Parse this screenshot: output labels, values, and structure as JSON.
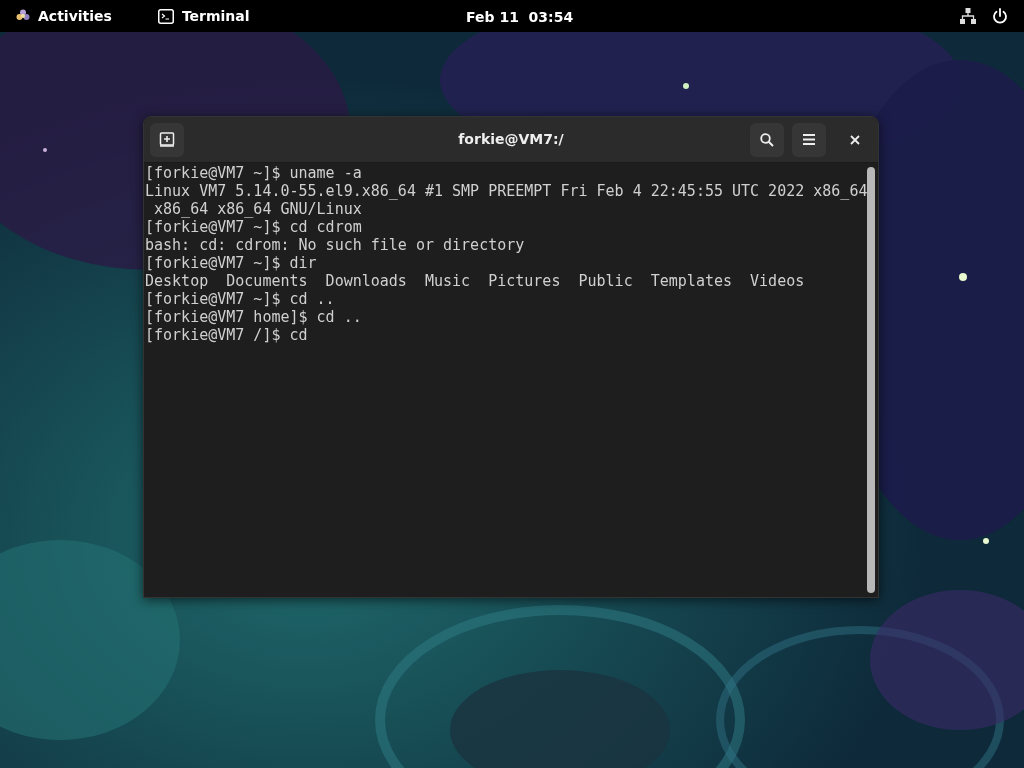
{
  "top_bar": {
    "activities": "Activities",
    "app_menu": "Terminal",
    "clock": "Feb 11  03:54"
  },
  "window": {
    "title": "forkie@VM7:/",
    "lines": [
      "[forkie@VM7 ~]$ uname -a",
      "Linux VM7 5.14.0-55.el9.x86_64 #1 SMP PREEMPT Fri Feb 4 22:45:55 UTC 2022 x86_64",
      " x86_64 x86_64 GNU/Linux",
      "[forkie@VM7 ~]$ cd cdrom",
      "bash: cd: cdrom: No such file or directory",
      "[forkie@VM7 ~]$ dir",
      "Desktop  Documents  Downloads  Music  Pictures  Public  Templates  Videos",
      "[forkie@VM7 ~]$ cd ..",
      "[forkie@VM7 home]$ cd ..",
      "[forkie@VM7 /]$ cd"
    ]
  }
}
